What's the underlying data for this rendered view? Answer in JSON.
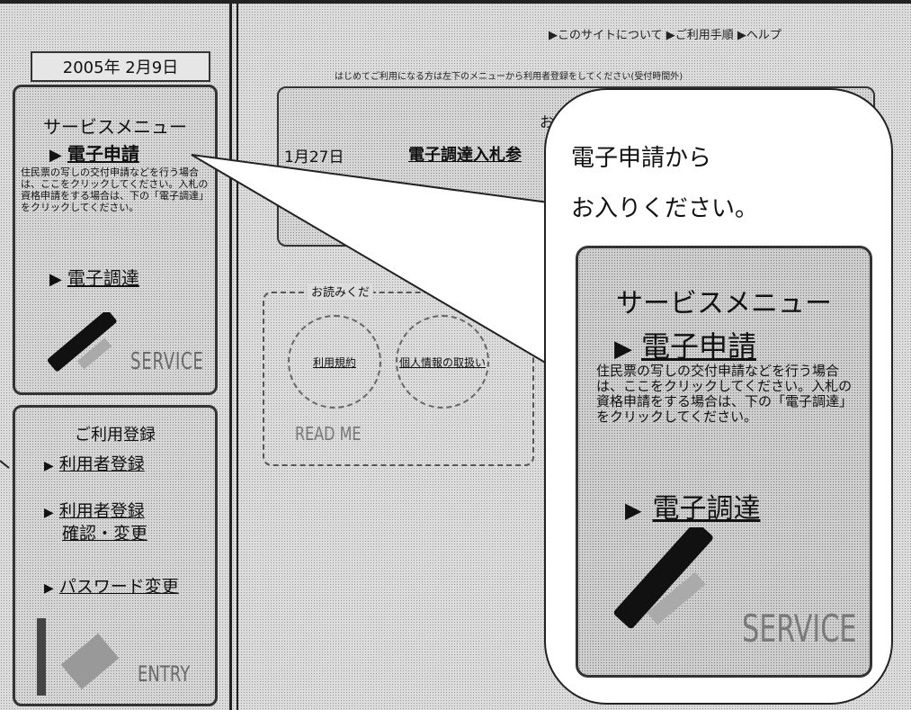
{
  "date": "2005年 2月9日",
  "top_links": "▶このサイトについて ▶ご利用手順 ▶ヘルプ",
  "first_time_notice": "はじめてご利用になる方は左下のメニューから利用者登録をしてください(受付時間外)",
  "service_menu": {
    "title": "サービスメニュー",
    "e_application": "電子申請",
    "description": "住民票の写しの交付申請などを行う場合は、ここをクリックしてください。入札の資格申請をする場合は、下の「電子調達」をクリックしてください。",
    "e_procurement": "電子調達",
    "badge": "SERVICE"
  },
  "registration": {
    "title": "ご利用登録",
    "user_registration": "利用者登録",
    "confirm_change_line1": "利用者登録",
    "confirm_change_line2": "確認・変更",
    "password_change": "パスワード変更",
    "badge": "ENTRY"
  },
  "notice": {
    "heading": "お知",
    "date": "1月27日",
    "title": "電子調達入札参"
  },
  "read_me": {
    "heading": "お読みくだ",
    "circle1": "利用規約",
    "circle2": "個人情報の取扱い",
    "label": "READ ME"
  },
  "callout": {
    "line1": "電子申請から",
    "line2": "お入りください。"
  },
  "zoom": {
    "title": "サービスメニュー",
    "e_application": "電子申請",
    "description": "住民票の写しの交付申請などを行う場合は、ここをクリックしてください。入札の資格申請をする場合は、下の「電子調達」をクリックしてください。",
    "e_procurement": "電子調達",
    "badge": "SERVICE"
  }
}
